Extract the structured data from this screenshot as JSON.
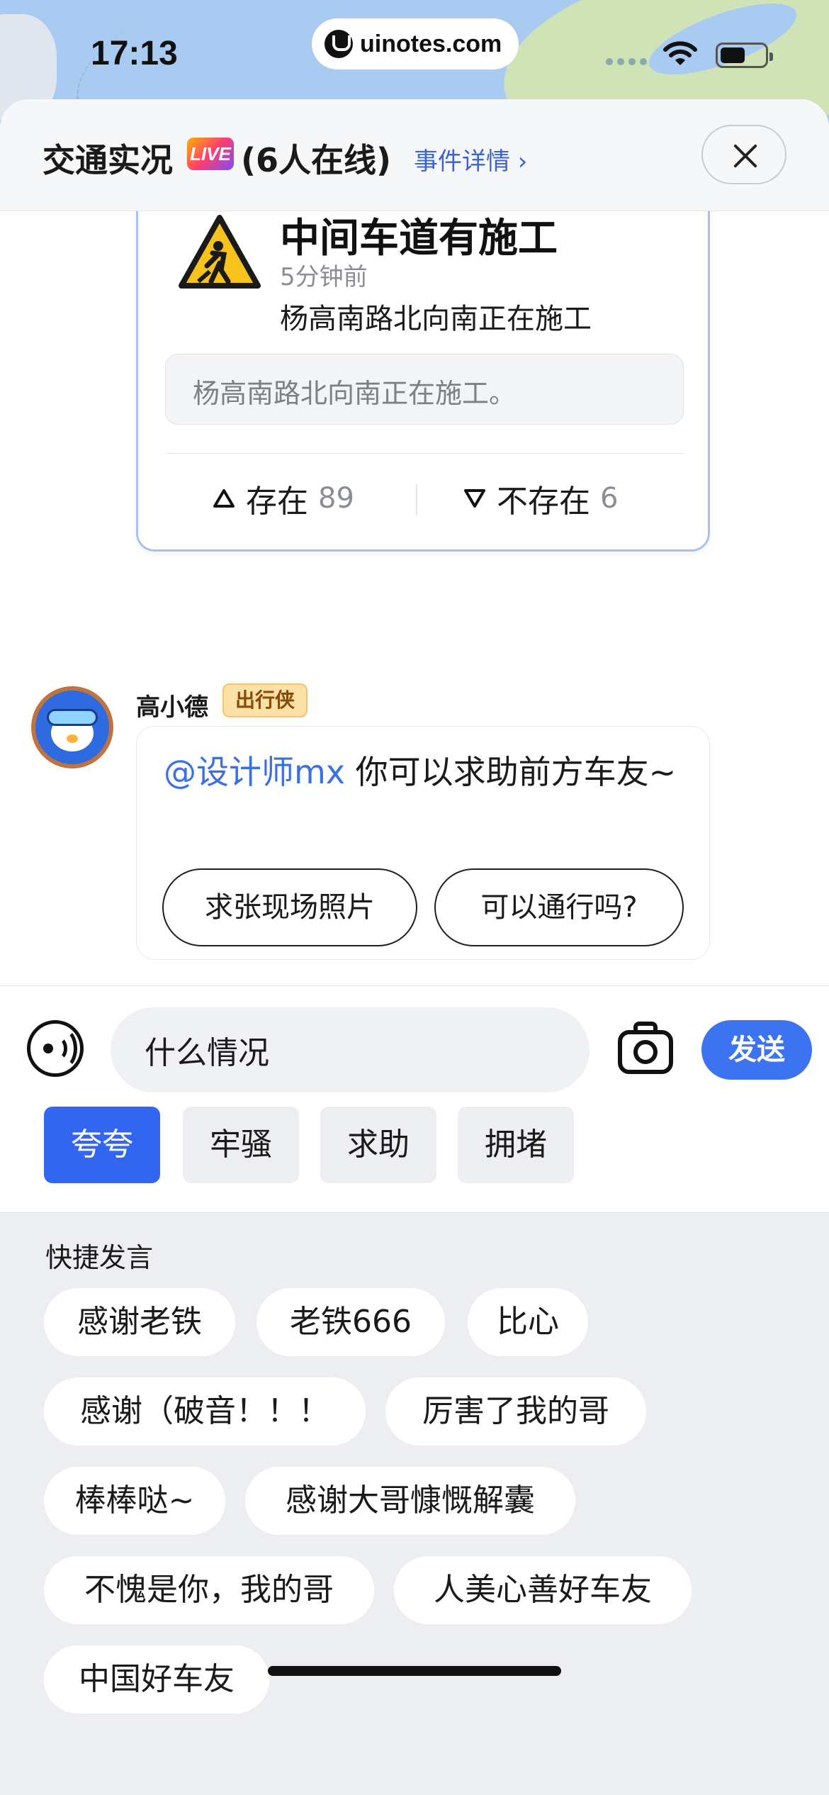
{
  "status_bar": {
    "time": "17:13",
    "url": "uinotes.com"
  },
  "header": {
    "title": "交通实况",
    "live_badge": "LIVE",
    "online": "(6人在线)",
    "event_link": "事件详情 ›"
  },
  "event_card": {
    "title": "中间车道有施工",
    "time": "5分钟前",
    "description": "杨高南路北向南正在施工",
    "quote": "杨高南路北向南正在施工。",
    "exists_label": "存在",
    "exists_count": "89",
    "not_exists_label": "不存在",
    "not_exists_count": "6"
  },
  "message": {
    "sender": "高小德",
    "badge": "出行侠",
    "mention": "@设计师mx",
    "text": " 你可以求助前方车友~",
    "suggestions": [
      "求张现场照片",
      "可以通行吗?"
    ]
  },
  "input": {
    "value": "什么情况",
    "send_label": "发送"
  },
  "tabs": [
    "夸夸",
    "牢骚",
    "求助",
    "拥堵"
  ],
  "quick": {
    "title": "快捷发言",
    "phrases": [
      "感谢老铁",
      "老铁666",
      "比心",
      "感谢（破音！！！",
      "厉害了我的哥",
      "棒棒哒~",
      "感谢大哥慷慨解囊",
      "不愧是你，我的哥",
      "人美心善好车友",
      "中国好车友"
    ]
  },
  "colors": {
    "accent": "#3366f0",
    "send": "#3b73f0",
    "mention": "#3a6fe8",
    "badge": "#fbe1a6"
  }
}
